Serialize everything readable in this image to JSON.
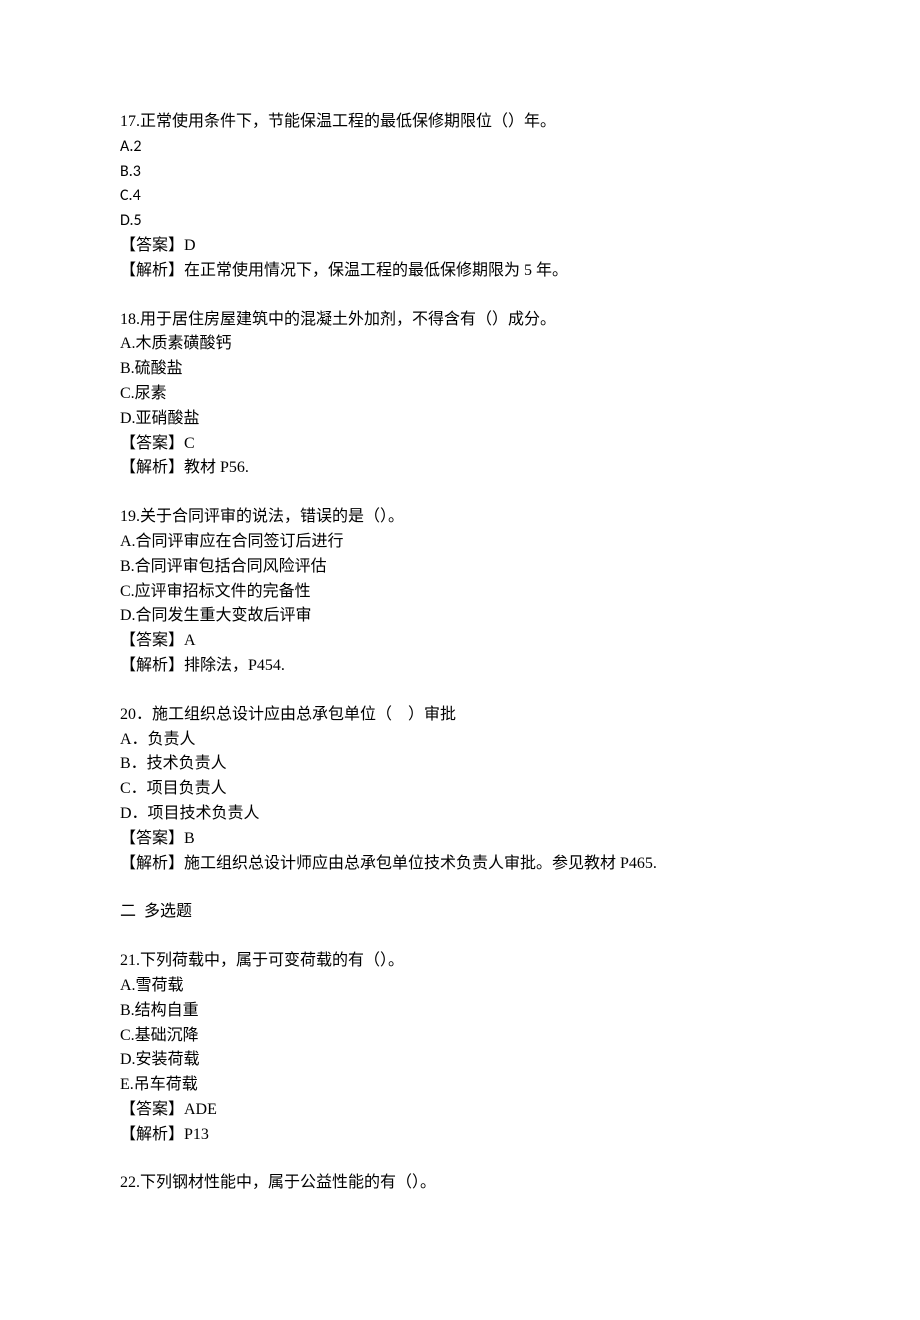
{
  "q17": {
    "stem": "17.正常使用条件下，节能保温工程的最低保修期限位（）年。",
    "opts": [
      "A.2",
      "B.3",
      "C.4",
      "D.5"
    ],
    "ans": "【答案】D",
    "exp": "【解析】在正常使用情况下，保温工程的最低保修期限为 5 年。"
  },
  "q18": {
    "stem": "18.用于居住房屋建筑中的混凝土外加剂，不得含有（）成分。",
    "opts": [
      "A.木质素磺酸钙",
      "B.硫酸盐",
      "C.尿素",
      "D.亚硝酸盐"
    ],
    "ans": "【答案】C",
    "exp": "【解析】教材 P56."
  },
  "q19": {
    "stem": "19.关于合同评审的说法，错误的是（）。",
    "opts": [
      "A.合同评审应在合同签订后进行",
      "B.合同评审包括合同风险评估",
      "C.应评审招标文件的完备性",
      "D.合同发生重大变故后评审"
    ],
    "ans": "【答案】A",
    "exp": "【解析】排除法，P454."
  },
  "q20": {
    "stem": "20．施工组织总设计应由总承包单位（    ）审批",
    "opts": [
      "A．负责人",
      "B．技术负责人",
      "C．项目负责人",
      "D．项目技术负责人"
    ],
    "ans": "【答案】B",
    "exp": "【解析】施工组织总设计师应由总承包单位技术负责人审批。参见教材 P465."
  },
  "section2": "二  多选题",
  "q21": {
    "stem": "21.下列荷载中，属于可变荷载的有（）。",
    "opts": [
      "A.雪荷载",
      "B.结构自重",
      "C.基础沉降",
      "D.安装荷载",
      "E.吊车荷载"
    ],
    "ans": "【答案】ADE",
    "exp": "【解析】P13"
  },
  "q22": {
    "stem": "22.下列钢材性能中，属于公益性能的有（）。"
  }
}
